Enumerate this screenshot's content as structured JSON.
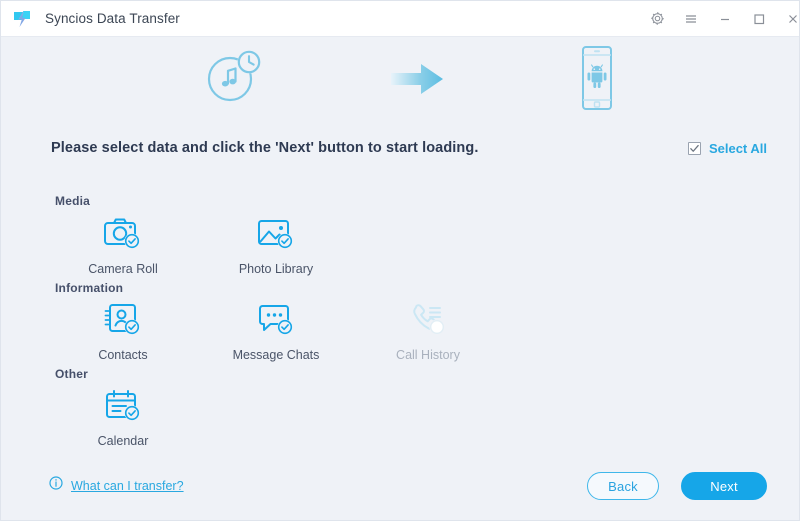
{
  "window": {
    "title": "Syncios Data Transfer",
    "logo_icon": "syncios-logo-icon",
    "controls": [
      {
        "name": "settings",
        "icon": "gear-icon"
      },
      {
        "name": "menu",
        "icon": "hamburger-menu-icon"
      },
      {
        "name": "minimize",
        "icon": "minimize-icon"
      },
      {
        "name": "maximize",
        "icon": "maximize-icon"
      },
      {
        "name": "close",
        "icon": "close-icon"
      }
    ]
  },
  "hero": {
    "source_icon": "music-restore-icon",
    "arrow_icon": "arrow-right-icon",
    "target_icon": "android-phone-icon"
  },
  "instruction": {
    "text": "Please select data and click the 'Next' button to start loading.",
    "select_all_label": "Select All",
    "select_all_checked": true,
    "checkbox_icon": "checkbox-checked-icon"
  },
  "sections": [
    {
      "title": "Media",
      "items": [
        {
          "label": "Camera Roll",
          "icon": "camera-icon",
          "checked": true,
          "enabled": true
        },
        {
          "label": "Photo Library",
          "icon": "picture-icon",
          "checked": true,
          "enabled": true
        }
      ]
    },
    {
      "title": "Information",
      "items": [
        {
          "label": "Contacts",
          "icon": "contact-card-icon",
          "checked": true,
          "enabled": true
        },
        {
          "label": "Message Chats",
          "icon": "chat-bubble-icon",
          "checked": true,
          "enabled": true
        },
        {
          "label": "Call History",
          "icon": "phone-handset-icon",
          "checked": false,
          "enabled": false
        }
      ]
    },
    {
      "title": "Other",
      "items": [
        {
          "label": "Calendar",
          "icon": "calendar-icon",
          "checked": true,
          "enabled": true
        }
      ]
    }
  ],
  "footer": {
    "help_icon": "info-circle-icon",
    "help_label": "What can I transfer?",
    "back_label": "Back",
    "next_label": "Next"
  },
  "colors": {
    "accent": "#16a6e8",
    "accent_light": "#7ec8e6",
    "background": "#eff2f7",
    "titlebar": "#ffffff",
    "heading_text": "#2e3a52",
    "disabled_text": "#a9b1bd"
  }
}
